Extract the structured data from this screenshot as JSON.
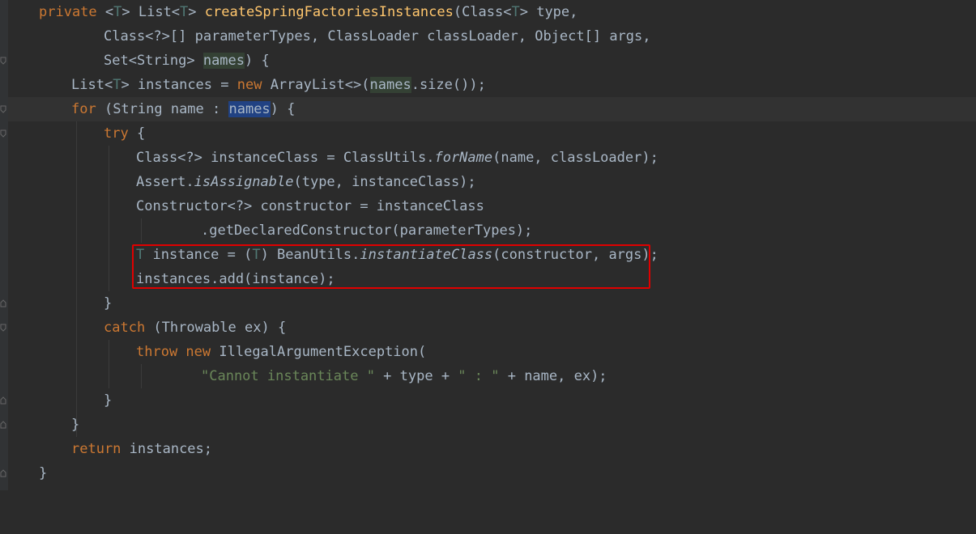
{
  "editor": {
    "theme": "darcula",
    "colors": {
      "background": "#2b2b2b",
      "keyword": "#cc7832",
      "method": "#ffc66d",
      "type_param": "#507874",
      "string": "#6a8759",
      "plain": "#a9b7c6",
      "highlight_box": "#e00000",
      "selection": "#214283"
    },
    "lines": [
      {
        "kw1": "private ",
        "p1": "<",
        "tp1": "T",
        "p2": "> List<",
        "tp2": "T",
        "p3": "> ",
        "fn": "createSpringFactoriesInstances",
        "p4": "(Class<",
        "tp3": "T",
        "p5": "> type,"
      },
      {
        "p1": "Class<?>[] parameterTypes, ClassLoader classLoader, Object[] args,"
      },
      {
        "p1": "Set<String> ",
        "hl": "names",
        "p2": ") {"
      },
      {
        "p1": "List<",
        "tp1": "T",
        "p2": "> instances = ",
        "kw1": "new ",
        "p3": "ArrayList<>(",
        "hl": "names",
        "p4": ".size());"
      },
      {
        "kw1": "for ",
        "p1": "(String name : ",
        "sel": "names",
        "p2": ") {"
      },
      {
        "kw1": "try ",
        "p1": "{"
      },
      {
        "p1": "Class<?> instanceClass = ClassUtils.",
        "it": "forName",
        "p2": "(name, classLoader);"
      },
      {
        "p1": "Assert.",
        "it": "isAssignable",
        "p2": "(type, instanceClass);"
      },
      {
        "p1": "Constructor<?> constructor = instanceClass"
      },
      {
        "p1": ".getDeclaredConstructor(parameterTypes);"
      },
      {
        "tp1": "T",
        "p1": " instance = (",
        "tp2": "T",
        "p2": ") BeanUtils.",
        "it": "instantiateClass",
        "p3": "(constructor, args);"
      },
      {
        "p1": "instances.add(instance);"
      },
      {
        "p1": "}"
      },
      {
        "kw1": "catch ",
        "p1": "(Throwable ex) {"
      },
      {
        "kw1": "throw ",
        "kw2": "new ",
        "p1": "IllegalArgumentException("
      },
      {
        "st1": "\"Cannot instantiate \"",
        "p1": " + type + ",
        "st2": "\" : \"",
        "p2": " + name, ex);"
      },
      {
        "p1": "}"
      },
      {
        "p1": "}"
      },
      {
        "kw1": "return ",
        "p1": "instances;"
      },
      {
        "p1": "}"
      }
    ]
  }
}
